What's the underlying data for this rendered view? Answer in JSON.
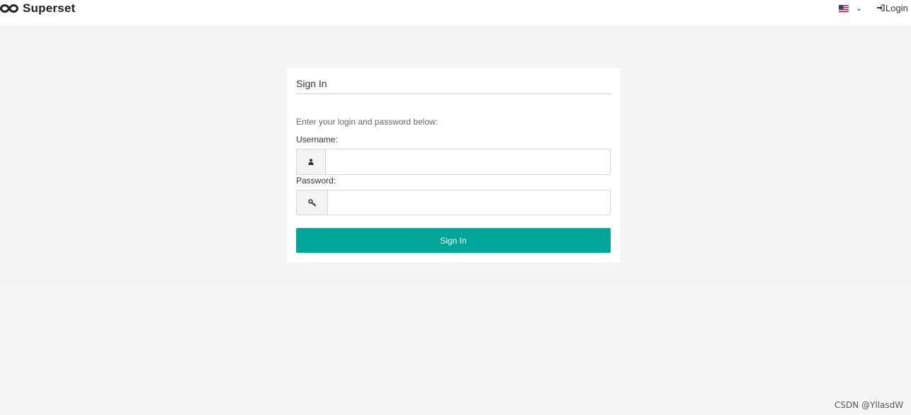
{
  "navbar": {
    "brand_name": "Superset",
    "brand_icon": "infinity-logo-icon",
    "language_icon": "us-flag-icon",
    "language_dropdown_icon": "chevron-down-icon",
    "login_icon": "sign-in-icon",
    "login_label": "Login"
  },
  "login_card": {
    "title": "Sign In",
    "instructions": "Enter your login and password below:",
    "username_label": "Username:",
    "username_icon": "user-icon",
    "username_value": "",
    "password_label": "Password:",
    "password_icon": "key-icon",
    "password_value": "",
    "submit_label": "Sign In"
  },
  "colors": {
    "accent": "#00a699",
    "background": "#f5f5f5",
    "card": "#ffffff"
  },
  "watermark": "CSDN @YllasdW"
}
